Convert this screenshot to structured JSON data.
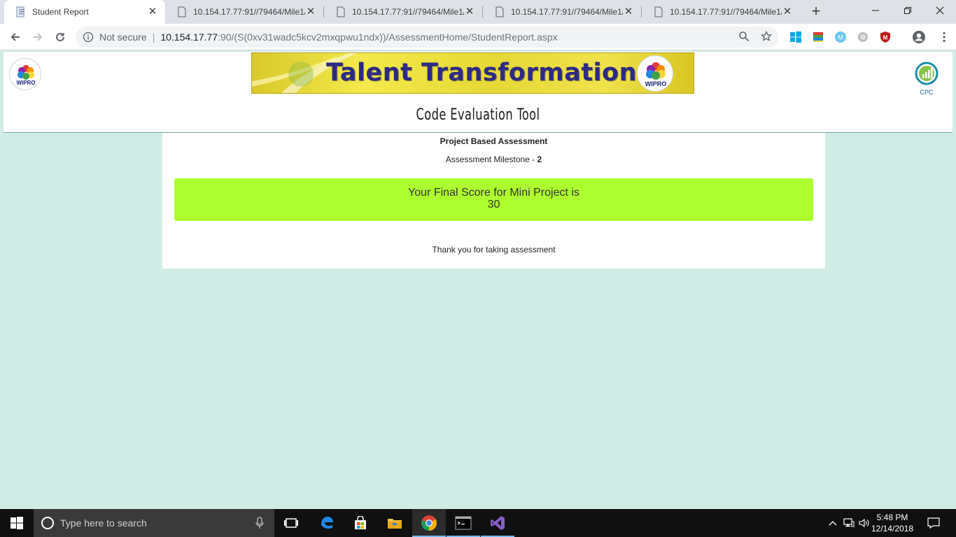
{
  "browser": {
    "tabs": [
      {
        "title": "Student Report",
        "active": true
      },
      {
        "title": "10.154.17.77:91//79464/Mile1/",
        "active": false
      },
      {
        "title": "10.154.17.77:91//79464/Mile1/",
        "active": false
      },
      {
        "title": "10.154.17.77:91//79464/Mile1/",
        "active": false
      },
      {
        "title": "10.154.17.77:91//79464/Mile1/",
        "active": false
      }
    ],
    "address": {
      "security_label": "Not secure",
      "host": "10.154.17.77",
      "path": ":90/(S(0xv31wadc5kcv2mxqpwu1ndx))/AssessmentHome/StudentReport.aspx"
    }
  },
  "header": {
    "logo_left": "WIPRO",
    "banner_title": "Talent Transformation",
    "banner_logo": "WIPRO",
    "logo_right": "CPC",
    "tool_title": "Code Evaluation Tool"
  },
  "report": {
    "assessment_type": "Project Based Assessment",
    "milestone_label": "Assessment Milestone - ",
    "milestone_value": "2",
    "score_label": "Your Final Score for Mini Project is",
    "score_value": "30",
    "thanks": "Thank you for taking assessment"
  },
  "taskbar": {
    "search_placeholder": "Type here to search",
    "time": "5:48 PM",
    "date": "12/14/2018"
  },
  "colors": {
    "page_background": "#d1ebe5",
    "score_box": "#adff2f",
    "banner_text": "#2d2a86"
  }
}
